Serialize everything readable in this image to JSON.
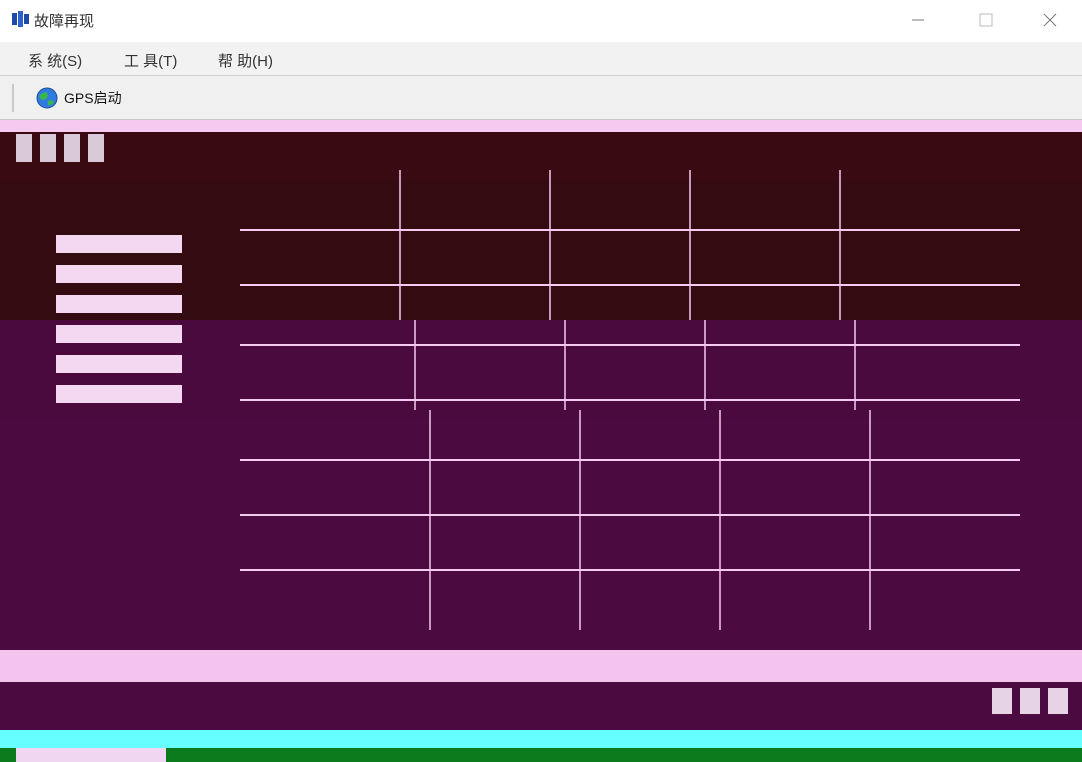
{
  "window": {
    "title": "故障再现"
  },
  "menu": {
    "items": [
      {
        "label": "系 统(S)"
      },
      {
        "label": "工 具(T)"
      },
      {
        "label": "帮 助(H)"
      }
    ]
  },
  "toolbar": {
    "gps_button_label": "GPS启动",
    "gps_icon": "globe-icon"
  },
  "colors": {
    "band_dark": "#330b10",
    "band_purple": "#4b0a40",
    "band_pink": "#f4c4ef",
    "band_cyan": "#66ffff",
    "band_green": "#0b7a1d"
  }
}
